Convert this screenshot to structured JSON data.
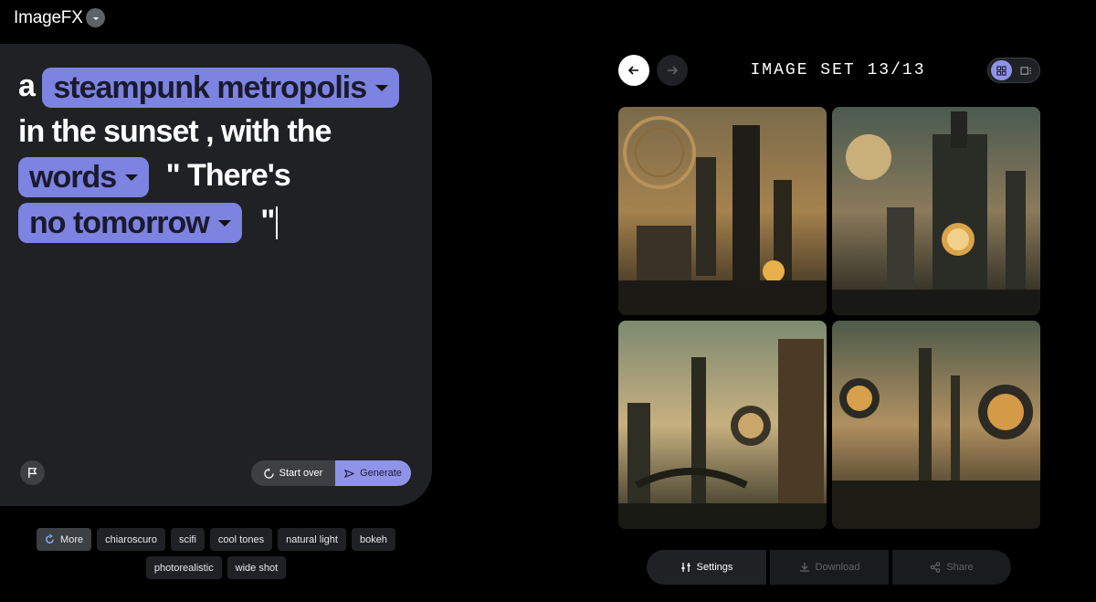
{
  "header": {
    "app_title": "ImageFX"
  },
  "prompt": {
    "word_a": "a",
    "chip1": "steampunk metropolis",
    "line2": "in the sunset , with the",
    "chip2": "words",
    "text3": "\" There's",
    "chip3": "no tomorrow",
    "text4": "\"",
    "start_over_label": "Start over",
    "generate_label": "Generate"
  },
  "suggestions": {
    "more_label": "More",
    "items": [
      "chiaroscuro",
      "scifi",
      "cool tones",
      "natural light",
      "bokeh",
      "photorealistic",
      "wide shot"
    ]
  },
  "viewer": {
    "set_title": "IMAGE SET 13/13",
    "settings_label": "Settings",
    "download_label": "Download",
    "share_label": "Share"
  },
  "colors": {
    "chip_bg": "#7c83e0",
    "accent": "#8f94e8",
    "panel_bg": "#202124"
  },
  "icons": [
    "chevron-down-icon",
    "flag-icon",
    "refresh-icon",
    "sparkle-send-icon",
    "arrow-left-icon",
    "arrow-right-icon",
    "grid-view-icon",
    "single-view-icon",
    "sliders-icon",
    "download-icon",
    "share-icon"
  ]
}
